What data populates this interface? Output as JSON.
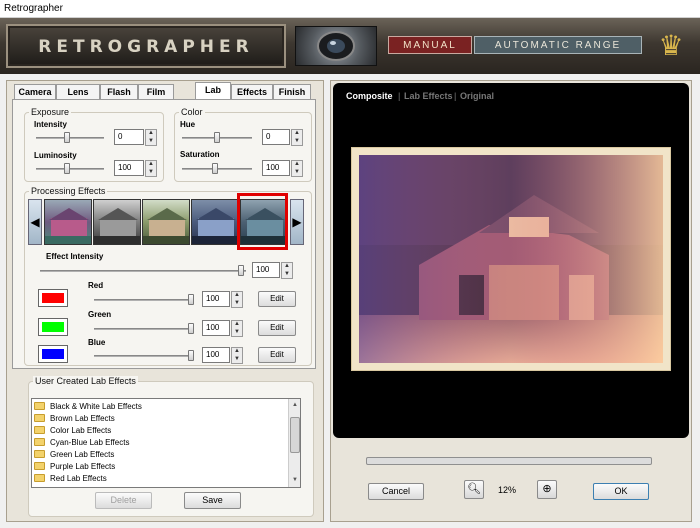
{
  "window": {
    "title": "Retrographer"
  },
  "header": {
    "logo_text": "RETROGRAPHER",
    "manual_label": "MANUAL",
    "automatic_label": "AUTOMATIC RANGE",
    "icons": {
      "camera": "camera-lens-icon",
      "crown": "crown-logo-icon"
    }
  },
  "tabs": [
    {
      "label": "Camera",
      "active": false
    },
    {
      "label": "Lens",
      "active": false
    },
    {
      "label": "Flash",
      "active": false
    },
    {
      "label": "Film",
      "active": false
    },
    {
      "label": "Lab",
      "active": true
    },
    {
      "label": "Effects",
      "active": false
    },
    {
      "label": "Finish",
      "active": false
    }
  ],
  "exposure": {
    "title": "Exposure",
    "intensity_label": "Intensity",
    "intensity_value": "0",
    "luminosity_label": "Luminosity",
    "luminosity_value": "100"
  },
  "color": {
    "title": "Color",
    "hue_label": "Hue",
    "hue_value": "0",
    "saturation_label": "Saturation",
    "saturation_value": "100"
  },
  "processing": {
    "title": "Processing Effects",
    "selected_index": 4,
    "effect_intensity_label": "Effect Intensity",
    "effect_intensity_value": "100",
    "channels": [
      {
        "label": "Red",
        "value": "100",
        "swatch": "#ff0000",
        "edit_label": "Edit"
      },
      {
        "label": "Green",
        "value": "100",
        "swatch": "#00ff00",
        "edit_label": "Edit"
      },
      {
        "label": "Blue",
        "value": "100",
        "swatch": "#0000ff",
        "edit_label": "Edit"
      }
    ]
  },
  "user_effects": {
    "title": "User Created Lab Effects",
    "items": [
      "Black & White Lab Effects",
      "Brown Lab Effects",
      "Color Lab Effects",
      "Cyan-Blue Lab Effects",
      "Green Lab Effects",
      "Purple Lab Effects",
      "Red Lab Effects"
    ],
    "delete_label": "Delete",
    "save_label": "Save"
  },
  "preview": {
    "tabs": [
      "Composite",
      "Lab Effects",
      "Original"
    ],
    "active_tab": "Composite",
    "separator": "|"
  },
  "footer": {
    "cancel_label": "Cancel",
    "zoom_value": "12%",
    "ok_label": "OK"
  },
  "colors": {
    "selection_border": "#e00000",
    "manual_bg": "#7a2222",
    "automatic_bg": "#4f5f66"
  }
}
